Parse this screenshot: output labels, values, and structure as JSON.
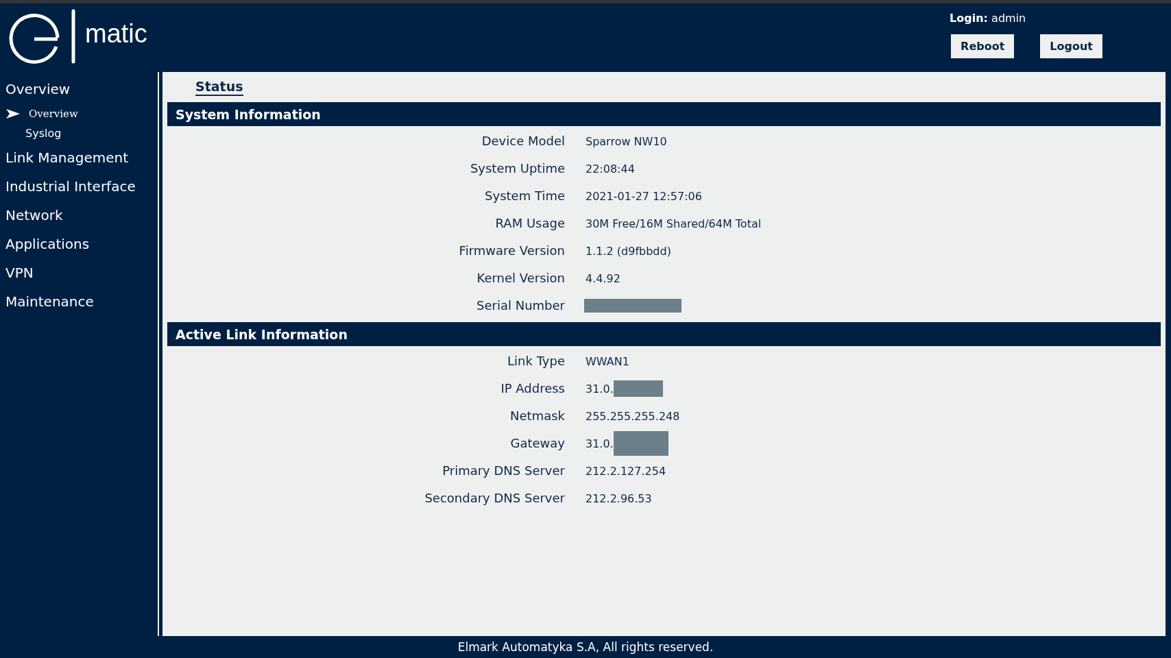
{
  "header": {
    "logo_text": "matic",
    "login_label": "Login:",
    "login_user": "admin",
    "buttons": [
      "Reboot",
      "Logout"
    ]
  },
  "sidebar": {
    "items": [
      {
        "label": "Overview",
        "children": [
          {
            "label": "Overview",
            "selected": true
          },
          {
            "label": "Syslog",
            "selected": false
          }
        ]
      },
      {
        "label": "Link Management"
      },
      {
        "label": "Industrial Interface"
      },
      {
        "label": "Network"
      },
      {
        "label": "Applications"
      },
      {
        "label": "VPN"
      },
      {
        "label": "Maintenance"
      }
    ]
  },
  "tabs": [
    {
      "label": "Status",
      "selected": true
    }
  ],
  "sections": [
    {
      "title": "System Information",
      "rows": [
        {
          "label": "Device Model",
          "value": "Sparrow NW10"
        },
        {
          "label": "System Uptime",
          "value": "22:08:44"
        },
        {
          "label": "System Time",
          "value": "2021-01-27 12:57:06"
        },
        {
          "label": "RAM Usage",
          "value": "30M Free/16M Shared/64M Total"
        },
        {
          "label": "Firmware Version",
          "value": "1.1.2 (d9fbbdd)"
        },
        {
          "label": "Kernel Version",
          "value": "4.4.92"
        },
        {
          "label": "Serial Number",
          "redacted": true
        }
      ]
    },
    {
      "title": "Active Link Information",
      "rows": [
        {
          "label": "Link Type",
          "value": "WWAN1"
        },
        {
          "label": "IP Address",
          "value": "31.0.",
          "redacted": true
        },
        {
          "label": "Netmask",
          "value": "255.255.255.248"
        },
        {
          "label": "Gateway",
          "value": "31.0.",
          "redacted": true
        },
        {
          "label": "Primary DNS Server",
          "value": "212.2.127.254"
        },
        {
          "label": "Secondary DNS Server",
          "value": "212.2.96.53"
        }
      ]
    }
  ],
  "footer": "Elmark Automatyka S.A, All rights reserved."
}
